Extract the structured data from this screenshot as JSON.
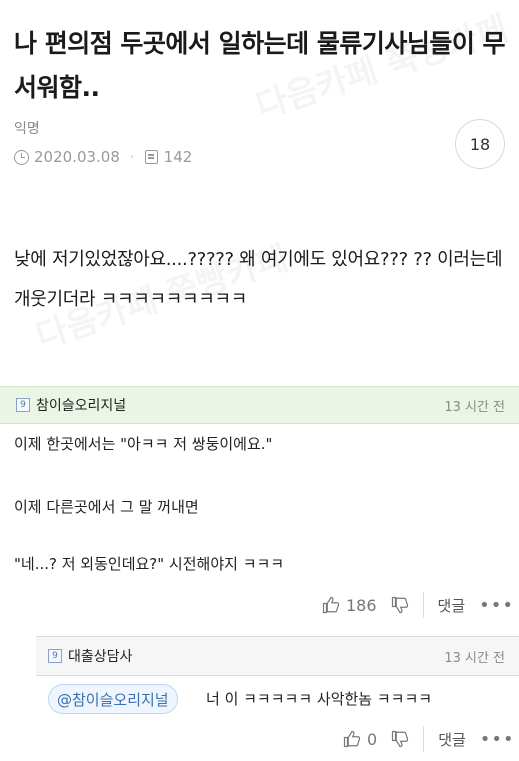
{
  "post": {
    "title": "나 편의점 두곳에서 일하는데 물류기사님들이 무서워함..",
    "author": "익명",
    "date": "2020.03.08",
    "views": "142",
    "comment_count": "18",
    "body": "낮에 저기있었잖아요....????? 왜 여기에도 있어요??? ?? 이러는데 개웃기더라 ㅋㅋㅋㅋㅋㅋㅋㅋㅋ"
  },
  "comment": {
    "level": "9",
    "nickname": "참이슬오리지널",
    "time": "13 시간 전",
    "lines": [
      "이제 한곳에서는 \"아ㅋㅋ 저 쌍둥이에요.\"",
      "이제 다른곳에서 그 말 꺼내면",
      "\"네...? 저 외동인데요?\" 시전해야지 ㅋㅋㅋ"
    ],
    "likes": "186",
    "reply_label": "댓글",
    "more_label": "•••"
  },
  "reply": {
    "level": "9",
    "nickname": "대출상담사",
    "time": "13 시간 전",
    "mention": "@참이슬오리지널",
    "text": "너 이 ㅋㅋㅋㅋㅋ 사악한놈 ㅋㅋㅋㅋ",
    "likes": "0",
    "reply_label": "댓글",
    "more_label": "•••"
  },
  "watermark": {
    "text": "다음카페 쭉빵카페"
  },
  "icons": {
    "clock": "clock-icon",
    "views": "views-icon",
    "like": "thumbs-up-icon",
    "dislike": "thumbs-down-icon",
    "more": "more-icon",
    "level": "level-badge-icon"
  },
  "colors": {
    "comment_header_bg": "#eaf5e5",
    "reply_header_bg": "#f6f6f6",
    "mention_text": "#3a6fb0"
  }
}
